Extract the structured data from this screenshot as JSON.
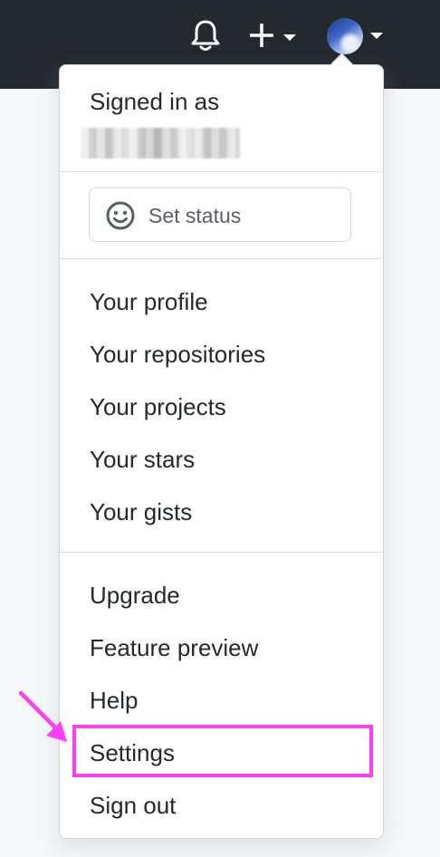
{
  "colors": {
    "topbar": "#24292f",
    "menu_bg": "#ffffff",
    "menu_border": "#d0d7de",
    "text": "#24292f",
    "muted_text": "#57606a",
    "highlight": "#ff3df5"
  },
  "topbar": {
    "icons": [
      "bell-icon",
      "plus-icon",
      "chevron-down-icon",
      "avatar"
    ]
  },
  "menu": {
    "signed_in_label": "Signed in as",
    "set_status_label": "Set status",
    "profile_items": [
      "Your profile",
      "Your repositories",
      "Your projects",
      "Your stars",
      "Your gists"
    ],
    "extra_items": [
      "Upgrade",
      "Feature preview",
      "Help",
      "Settings",
      "Sign out"
    ]
  },
  "annotation": {
    "highlighted_item": "Settings",
    "arrow_icon": "arrow-pointer-icon"
  }
}
